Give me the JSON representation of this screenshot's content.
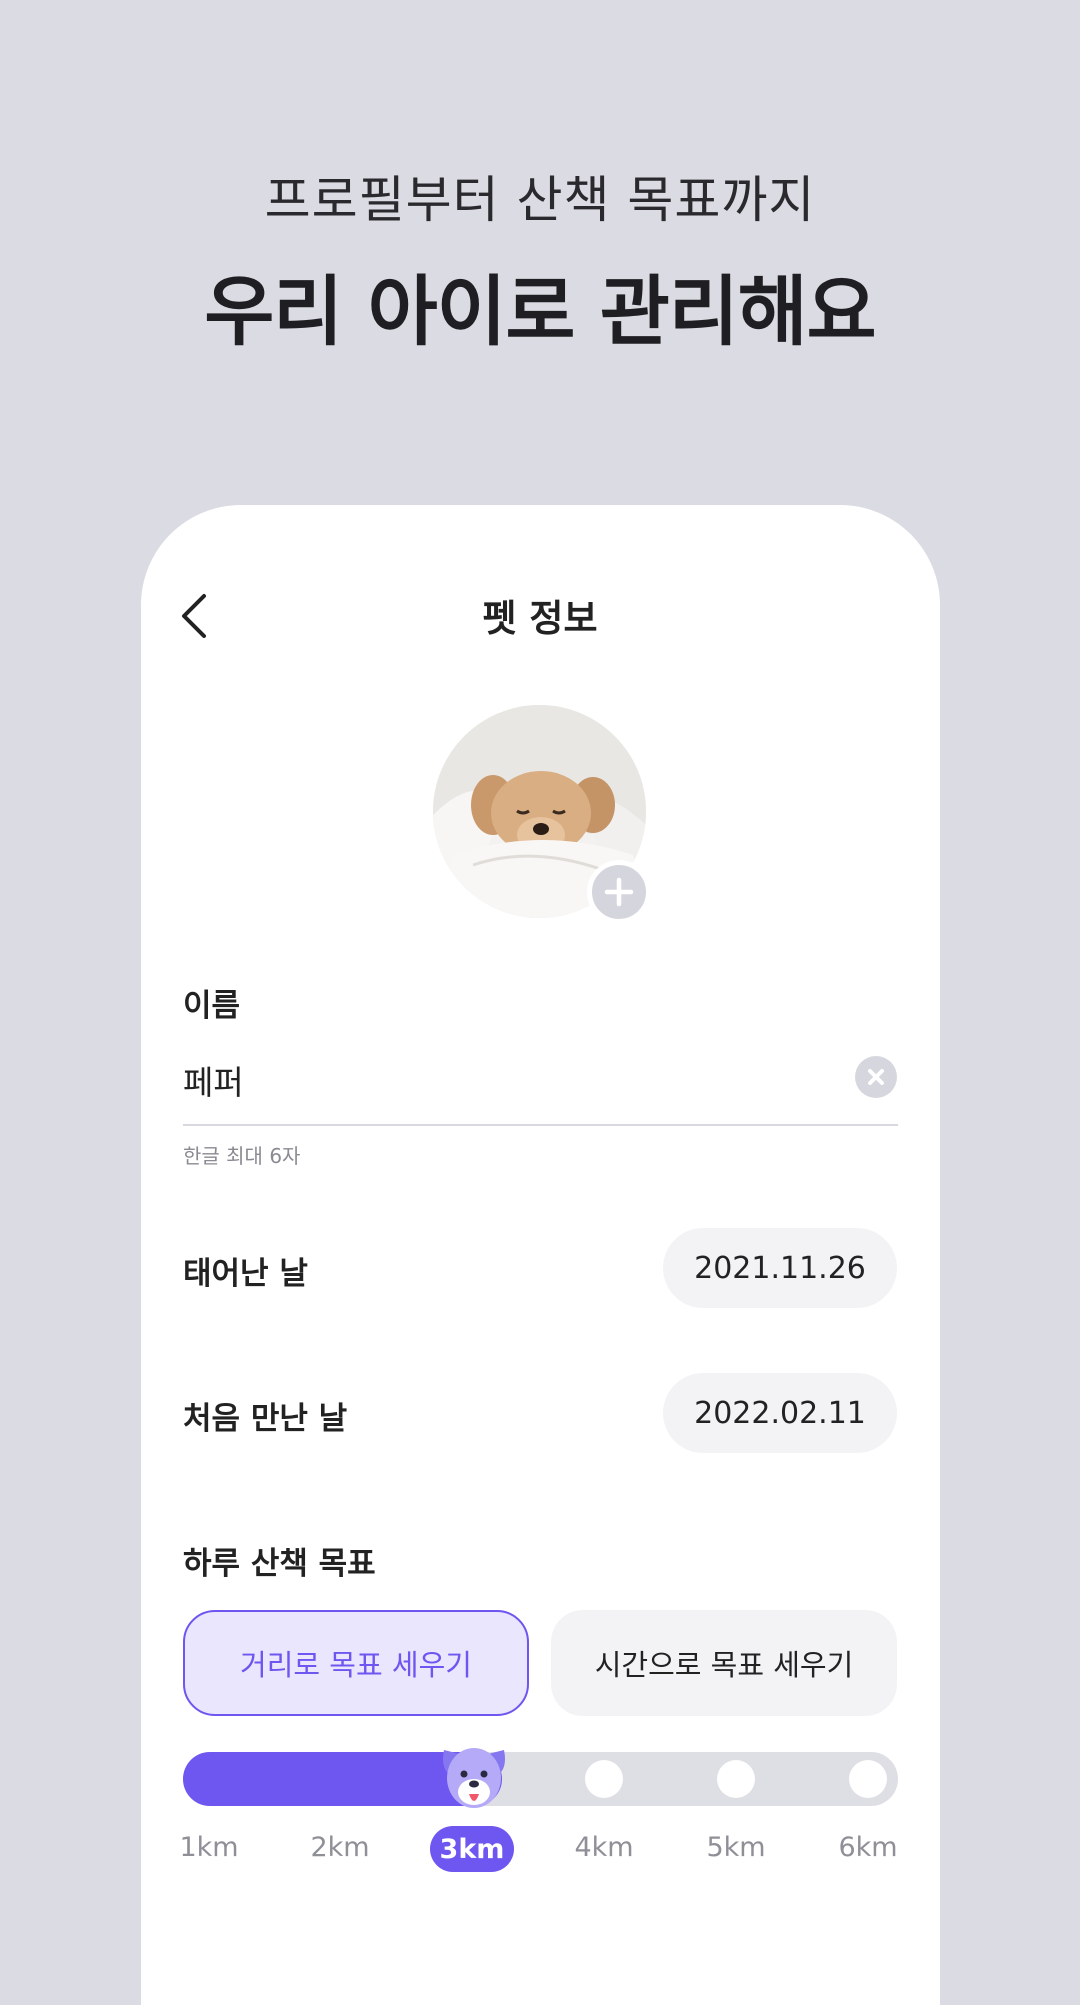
{
  "hero": {
    "subtitle": "프로필부터 산책 목표까지",
    "title": "우리 아이로 관리해요"
  },
  "header": {
    "title": "펫 정보",
    "back_icon": "chevron-left-icon"
  },
  "profile": {
    "photo_desc": "dog-photo",
    "add_icon": "plus-icon"
  },
  "name_field": {
    "label": "이름",
    "value": "페퍼",
    "hint": "한글 최대 6자",
    "clear_icon": "close-icon"
  },
  "birthday": {
    "label": "태어난 날",
    "value": "2021.11.26"
  },
  "first_met": {
    "label": "처음 만난 날",
    "value": "2022.02.11"
  },
  "walk_goal": {
    "label": "하루 산책 목표",
    "modes": [
      "거리로 목표 세우기",
      "시간으로 목표 세우기"
    ],
    "selected_mode": 0,
    "options": [
      "1km",
      "2km",
      "3km",
      "4km",
      "5km",
      "6km"
    ],
    "selected_index": 2
  },
  "colors": {
    "background": "#DBDBE3",
    "accent": "#6E56F0",
    "accent_light": "#E9E6FD",
    "pill": "#F3F3F6"
  }
}
